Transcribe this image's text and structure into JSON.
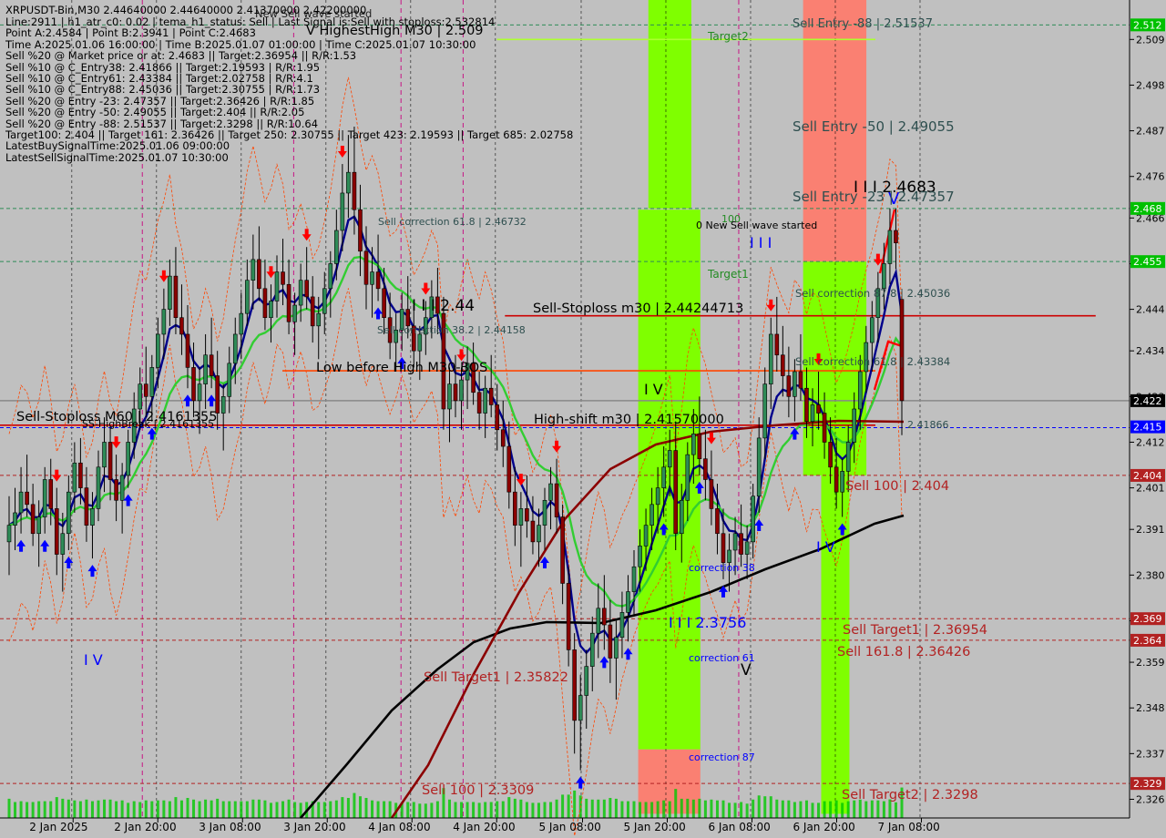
{
  "header": {
    "symbol": "XRPUSDT-Bin,M30",
    "ohlc": "2.44640000 2.44640000 2.41370000 2.42200000",
    "overlay_status": "New Sell wave started"
  },
  "info_lines": [
    "Line:2911 | h1_atr_c0: 0.02 | tema_h1_status: Sell | Last Signal is:Sell with stoploss:2.532814",
    "Point A:2.4584 | Point B:2.3941 | Point C:2.4683",
    "Time A:2025.01.06 16:00:00 | Time B:2025.01.07 01:00:00 | Time C:2025.01.07 10:30:00",
    "Sell %20 @ Market price or at: 2.4683 || Target:2.36954 || R/R:1.53",
    "Sell %10 @ C_Entry38: 2.41866 || Target:2.19593 | R/R:1.95",
    "Sell %10 @ C_Entry61: 2.43384 || Target:2.02758 | R/R:4.1",
    "Sell %10 @ C_Entry88: 2.45036 || Target:2.30755 | R/R:1.73",
    "Sell %20 @ Entry -23: 2.47357 || Target:2.36426 | R/R:1.85",
    "Sell %20 @ Entry -50: 2.49055 || Target:2.404 || R/R:2.05",
    "Sell %20 @ Entry -88: 2.51537 || Target:2.3298 || R/R:10.64",
    "Target100: 2.404 || Target 161: 2.36426 || Target 250: 2.30755 || Target 423: 2.19593 || Target 685: 2.02758",
    "LatestBuySignalTime:2025.01.06 09:00:00",
    "LatestSellSignalTime:2025.01.07 10:30:00"
  ],
  "chart_data": {
    "type": "candlestick",
    "symbol": "XRPUSDT-Bin",
    "timeframe": "M30",
    "ylim": [
      2.3215,
      2.5185
    ],
    "y_ticks": [
      "2.509",
      "2.498",
      "2.487",
      "2.476",
      "2.466",
      "2.455",
      "2.444",
      "2.434",
      "2.423",
      "2.412",
      "2.401",
      "2.391",
      "2.380",
      "2.369",
      "2.359",
      "2.348",
      "2.337",
      "2.326"
    ],
    "x_ticks": [
      "2 Jan 2025",
      "2 Jan 20:00",
      "3 Jan 08:00",
      "3 Jan 20:00",
      "4 Jan 08:00",
      "4 Jan 20:00",
      "5 Jan 08:00",
      "5 Jan 20:00",
      "6 Jan 08:00",
      "6 Jan 20:00",
      "7 Jan 08:00"
    ],
    "price_tags": [
      {
        "label": "2.512",
        "value": 2.5125,
        "color": "#00c000"
      },
      {
        "label": "2.468",
        "value": 2.4683,
        "color": "#00c000"
      },
      {
        "label": "2.455",
        "value": 2.4555,
        "color": "#00c000"
      },
      {
        "label": "2.422",
        "value": 2.422,
        "color": "#000000"
      },
      {
        "label": "2.415",
        "value": 2.4157,
        "color": "#0000ff"
      },
      {
        "label": "2.404",
        "value": 2.404,
        "color": "#b22222"
      },
      {
        "label": "2.369",
        "value": 2.3695,
        "color": "#b22222"
      },
      {
        "label": "2.364",
        "value": 2.3643,
        "color": "#b22222"
      },
      {
        "label": "2.329",
        "value": 2.3298,
        "color": "#b22222"
      }
    ],
    "horizontal_levels": [
      {
        "value": 2.509,
        "color": "#adff2f",
        "style": "solid"
      },
      {
        "value": 2.5125,
        "color": "#2e8b57",
        "style": "dash"
      },
      {
        "value": 2.4683,
        "color": "#2e8b57",
        "style": "dash"
      },
      {
        "value": 2.4555,
        "color": "#2e8b57",
        "style": "dash"
      },
      {
        "value": 2.44244713,
        "color": "#cc0000",
        "style": "solid"
      },
      {
        "value": 2.4292,
        "color": "#ff4500",
        "style": "solid"
      },
      {
        "value": 2.422,
        "color": "#888888",
        "style": "solid"
      },
      {
        "value": 2.4161,
        "color": "#cc0000",
        "style": "solid"
      },
      {
        "value": 2.4155,
        "color": "#0000ff",
        "style": "dash"
      },
      {
        "value": 2.404,
        "color": "#b22222",
        "style": "dash"
      },
      {
        "value": 2.3695,
        "color": "#b22222",
        "style": "dash"
      },
      {
        "value": 2.3643,
        "color": "#b22222",
        "style": "dash"
      },
      {
        "value": 2.3298,
        "color": "#b22222",
        "style": "dash"
      }
    ],
    "zones": [
      {
        "color": "#7fff00",
        "x0": 0.574,
        "x1": 0.612,
        "y_top": 2.5185,
        "y_bottom": 2.4683
      },
      {
        "color": "#7fff00",
        "x0": 0.565,
        "x1": 0.62,
        "y_top": 2.468,
        "y_bottom": 2.338
      },
      {
        "color": "#fa8072",
        "x0": 0.565,
        "x1": 0.62,
        "y_top": 2.338,
        "y_bottom": 2.3225
      },
      {
        "color": "#fa8072",
        "x0": 0.711,
        "x1": 0.767,
        "y_top": 2.5185,
        "y_bottom": 2.4555
      },
      {
        "color": "#7fff00",
        "x0": 0.711,
        "x1": 0.767,
        "y_top": 2.4555,
        "y_bottom": 2.404
      },
      {
        "color": "#7fff00",
        "x0": 0.727,
        "x1": 0.752,
        "y_top": 2.404,
        "y_bottom": 2.3225
      }
    ],
    "labels": [
      {
        "text": "Sell Entry -88 | 2.51537",
        "color": "#2f4f4f"
      },
      {
        "text": "Target2",
        "color": "#228b22"
      },
      {
        "text": "Sell Entry -50 | 2.49055",
        "color": "#2f4f4f"
      },
      {
        "text": "I I I 2.4683",
        "color": "#000000"
      },
      {
        "text": "V",
        "color": "#0000ff"
      },
      {
        "text": "Sell Entry -23 | 2.47357",
        "color": "#2f4f4f"
      },
      {
        "text": "Sell correction 61.8 | 2.46732",
        "color": "#2f4f4f"
      },
      {
        "text": "100",
        "color": "#228b22"
      },
      {
        "text": "0 New Sell wave started",
        "color": "#000000"
      },
      {
        "text": "I I I",
        "color": "#0000ff"
      },
      {
        "text": "Target1",
        "color": "#228b22"
      },
      {
        "text": "Sell correction 87.8 | 2.45036",
        "color": "#2f4f4f"
      },
      {
        "text": "I I I 2.44",
        "color": "#000000"
      },
      {
        "text": "Sell-Stoploss m30 | 2.44244713",
        "color": "#000000"
      },
      {
        "text": "Sell correction 38.2 | 2.44158",
        "color": "#2f4f4f"
      },
      {
        "text": "Sell correction 61.8 | 2.43384",
        "color": "#2f4f4f"
      },
      {
        "text": "Low before High   M30-BOS",
        "color": "#000000"
      },
      {
        "text": "I V",
        "color": "#000000"
      },
      {
        "text": "Sell-Stoploss M60 | 2.4161355",
        "color": "#000000"
      },
      {
        "text": "SS-HighBreak | 2.4161355",
        "color": "#000000"
      },
      {
        "text": "High-shift m30 | 2.41570000",
        "color": "#000000"
      },
      {
        "text": "2.41866",
        "color": "#2f4f4f"
      },
      {
        "text": "Sell 100 | 2.404",
        "color": "#b22222"
      },
      {
        "text": "I V",
        "color": "#0000ff"
      },
      {
        "text": "correction 38",
        "color": "#0000ff"
      },
      {
        "text": "I I I 2.3756",
        "color": "#0000ff"
      },
      {
        "text": "Sell Target1 | 2.36954",
        "color": "#b22222"
      },
      {
        "text": "Sell 161.8 | 2.36426",
        "color": "#b22222"
      },
      {
        "text": "I V",
        "color": "#0000ff"
      },
      {
        "text": "correction 61",
        "color": "#0000ff"
      },
      {
        "text": "V",
        "color": "#000000"
      },
      {
        "text": "Sell Target1 | 2.35822",
        "color": "#b22222"
      },
      {
        "text": "correction 87",
        "color": "#0000ff"
      },
      {
        "text": "Sell 100 | 2.3309",
        "color": "#b22222"
      },
      {
        "text": "Sell Target2 | 2.3298",
        "color": "#b22222"
      },
      {
        "text": "V   HighestHigh   M30 | 2.509",
        "color": "#000000"
      }
    ],
    "candles_ohlc": [
      [
        2.388,
        2.399,
        2.38,
        2.392
      ],
      [
        2.392,
        2.401,
        2.386,
        2.395
      ],
      [
        2.395,
        2.406,
        2.39,
        2.4
      ],
      [
        2.4,
        2.409,
        2.394,
        2.397
      ],
      [
        2.397,
        2.402,
        2.387,
        2.39
      ],
      [
        2.39,
        2.398,
        2.382,
        2.394
      ],
      [
        2.394,
        2.406,
        2.39,
        2.403
      ],
      [
        2.403,
        2.408,
        2.392,
        2.396
      ],
      [
        2.396,
        2.401,
        2.38,
        2.385
      ],
      [
        2.385,
        2.395,
        2.376,
        2.39
      ],
      [
        2.39,
        2.404,
        2.386,
        2.4
      ],
      [
        2.4,
        2.412,
        2.395,
        2.407
      ],
      [
        2.407,
        2.413,
        2.397,
        2.401
      ],
      [
        2.401,
        2.406,
        2.388,
        2.392
      ],
      [
        2.392,
        2.4,
        2.384,
        2.396
      ],
      [
        2.396,
        2.41,
        2.393,
        2.406
      ],
      [
        2.406,
        2.418,
        2.4,
        2.412
      ],
      [
        2.412,
        2.416,
        2.398,
        2.403
      ],
      [
        2.403,
        2.409,
        2.393,
        2.398
      ],
      [
        2.398,
        2.407,
        2.39,
        2.404
      ],
      [
        2.404,
        2.415,
        2.401,
        2.412
      ],
      [
        2.412,
        2.424,
        2.408,
        2.42
      ],
      [
        2.42,
        2.43,
        2.415,
        2.426
      ],
      [
        2.426,
        2.435,
        2.418,
        2.423
      ],
      [
        2.423,
        2.433,
        2.417,
        2.43
      ],
      [
        2.43,
        2.442,
        2.425,
        2.438
      ],
      [
        2.438,
        2.449,
        2.432,
        2.444
      ],
      [
        2.444,
        2.456,
        2.44,
        2.452
      ],
      [
        2.452,
        2.459,
        2.438,
        2.442
      ],
      [
        2.442,
        2.45,
        2.433,
        2.438
      ],
      [
        2.438,
        2.445,
        2.425,
        2.43
      ],
      [
        2.43,
        2.436,
        2.418,
        2.422
      ],
      [
        2.422,
        2.43,
        2.414,
        2.426
      ],
      [
        2.426,
        2.438,
        2.42,
        2.433
      ],
      [
        2.433,
        2.442,
        2.425,
        2.428
      ],
      [
        2.428,
        2.434,
        2.415,
        2.419
      ],
      [
        2.419,
        2.426,
        2.41,
        2.423
      ],
      [
        2.423,
        2.435,
        2.419,
        2.431
      ],
      [
        2.431,
        2.442,
        2.426,
        2.438
      ],
      [
        2.438,
        2.448,
        2.432,
        2.443
      ],
      [
        2.443,
        2.456,
        2.44,
        2.451
      ],
      [
        2.451,
        2.462,
        2.444,
        2.456
      ],
      [
        2.456,
        2.464,
        2.446,
        2.449
      ],
      [
        2.449,
        2.456,
        2.439,
        2.442
      ],
      [
        2.442,
        2.45,
        2.436,
        2.446
      ],
      [
        2.446,
        2.457,
        2.442,
        2.453
      ],
      [
        2.453,
        2.461,
        2.445,
        2.45
      ],
      [
        2.45,
        2.456,
        2.438,
        2.441
      ],
      [
        2.441,
        2.448,
        2.433,
        2.445
      ],
      [
        2.445,
        2.455,
        2.441,
        2.451
      ],
      [
        2.451,
        2.459,
        2.444,
        2.447
      ],
      [
        2.447,
        2.452,
        2.436,
        2.44
      ],
      [
        2.44,
        2.447,
        2.432,
        2.443
      ],
      [
        2.443,
        2.453,
        2.438,
        2.449
      ],
      [
        2.449,
        2.458,
        2.442,
        2.455
      ],
      [
        2.455,
        2.468,
        2.451,
        2.463
      ],
      [
        2.463,
        2.479,
        2.458,
        2.472
      ],
      [
        2.472,
        2.486,
        2.466,
        2.477
      ],
      [
        2.477,
        2.488,
        2.462,
        2.468
      ],
      [
        2.468,
        2.474,
        2.452,
        2.458
      ],
      [
        2.458,
        2.464,
        2.444,
        2.45
      ],
      [
        2.45,
        2.459,
        2.442,
        2.453
      ],
      [
        2.453,
        2.462,
        2.446,
        2.449
      ],
      [
        2.449,
        2.454,
        2.438,
        2.442
      ],
      [
        2.442,
        2.448,
        2.432,
        2.436
      ],
      [
        2.436,
        2.443,
        2.429,
        2.439
      ],
      [
        2.439,
        2.448,
        2.434,
        2.444
      ],
      [
        2.444,
        2.452,
        2.437,
        2.44
      ],
      [
        2.44,
        2.445,
        2.43,
        2.434
      ],
      [
        2.434,
        2.44,
        2.427,
        2.438
      ],
      [
        2.438,
        2.446,
        2.433,
        2.442
      ],
      [
        2.442,
        2.451,
        2.437,
        2.447
      ],
      [
        2.447,
        2.454,
        2.438,
        2.443
      ],
      [
        2.443,
        2.447,
        2.415,
        2.42
      ],
      [
        2.42,
        2.43,
        2.412,
        2.426
      ],
      [
        2.426,
        2.433,
        2.418,
        2.422
      ],
      [
        2.422,
        2.43,
        2.415,
        2.427
      ],
      [
        2.427,
        2.435,
        2.42,
        2.431
      ],
      [
        2.431,
        2.436,
        2.421,
        2.424
      ],
      [
        2.424,
        2.429,
        2.415,
        2.419
      ],
      [
        2.419,
        2.428,
        2.413,
        2.425
      ],
      [
        2.425,
        2.433,
        2.418,
        2.421
      ],
      [
        2.421,
        2.426,
        2.41,
        2.415
      ],
      [
        2.415,
        2.422,
        2.406,
        2.411
      ],
      [
        2.411,
        2.417,
        2.396,
        2.4
      ],
      [
        2.4,
        2.406,
        2.387,
        2.392
      ],
      [
        2.392,
        2.4,
        2.382,
        2.396
      ],
      [
        2.396,
        2.404,
        2.389,
        2.393
      ],
      [
        2.393,
        2.399,
        2.385,
        2.388
      ],
      [
        2.388,
        2.396,
        2.382,
        2.392
      ],
      [
        2.392,
        2.401,
        2.386,
        2.398
      ],
      [
        2.398,
        2.406,
        2.391,
        2.402
      ],
      [
        2.402,
        2.408,
        2.39,
        2.394
      ],
      [
        2.394,
        2.397,
        2.373,
        2.378
      ],
      [
        2.378,
        2.382,
        2.358,
        2.362
      ],
      [
        2.362,
        2.366,
        2.337,
        2.345
      ],
      [
        2.345,
        2.356,
        2.333,
        2.351
      ],
      [
        2.351,
        2.362,
        2.343,
        2.358
      ],
      [
        2.358,
        2.37,
        2.352,
        2.366
      ],
      [
        2.366,
        2.378,
        2.36,
        2.372
      ],
      [
        2.372,
        2.38,
        2.362,
        2.368
      ],
      [
        2.368,
        2.374,
        2.354,
        2.36
      ],
      [
        2.36,
        2.369,
        2.35,
        2.365
      ],
      [
        2.365,
        2.376,
        2.36,
        2.371
      ],
      [
        2.371,
        2.38,
        2.364,
        2.376
      ],
      [
        2.376,
        2.386,
        2.37,
        2.382
      ],
      [
        2.382,
        2.391,
        2.376,
        2.387
      ],
      [
        2.387,
        2.396,
        2.381,
        2.392
      ],
      [
        2.392,
        2.401,
        2.386,
        2.397
      ],
      [
        2.397,
        2.406,
        2.39,
        2.401
      ],
      [
        2.401,
        2.411,
        2.394,
        2.406
      ],
      [
        2.406,
        2.415,
        2.399,
        2.41
      ],
      [
        2.41,
        2.417,
        2.386,
        2.39
      ],
      [
        2.39,
        2.402,
        2.383,
        2.398
      ],
      [
        2.398,
        2.412,
        2.393,
        2.409
      ],
      [
        2.409,
        2.42,
        2.402,
        2.414
      ],
      [
        2.414,
        2.423,
        2.404,
        2.408
      ],
      [
        2.408,
        2.415,
        2.398,
        2.403
      ],
      [
        2.403,
        2.41,
        2.392,
        2.396
      ],
      [
        2.396,
        2.402,
        2.385,
        2.39
      ],
      [
        2.39,
        2.396,
        2.379,
        2.383
      ],
      [
        2.383,
        2.39,
        2.376,
        2.386
      ],
      [
        2.386,
        2.394,
        2.38,
        2.39
      ],
      [
        2.39,
        2.397,
        2.382,
        2.385
      ],
      [
        2.385,
        2.392,
        2.379,
        2.388
      ],
      [
        2.388,
        2.402,
        2.384,
        2.399
      ],
      [
        2.399,
        2.418,
        2.395,
        2.413
      ],
      [
        2.413,
        2.43,
        2.408,
        2.426
      ],
      [
        2.426,
        2.442,
        2.42,
        2.438
      ],
      [
        2.438,
        2.447,
        2.429,
        2.433
      ],
      [
        2.433,
        2.44,
        2.423,
        2.428
      ],
      [
        2.428,
        2.435,
        2.418,
        2.423
      ],
      [
        2.423,
        2.432,
        2.417,
        2.429
      ],
      [
        2.429,
        2.438,
        2.422,
        2.425
      ],
      [
        2.425,
        2.43,
        2.413,
        2.417
      ],
      [
        2.417,
        2.425,
        2.411,
        2.421
      ],
      [
        2.421,
        2.429,
        2.415,
        2.419
      ],
      [
        2.419,
        2.424,
        2.408,
        2.412
      ],
      [
        2.412,
        2.418,
        2.402,
        2.406
      ],
      [
        2.406,
        2.413,
        2.396,
        2.4
      ],
      [
        2.4,
        2.408,
        2.394,
        2.405
      ],
      [
        2.405,
        2.416,
        2.4,
        2.412
      ],
      [
        2.412,
        2.424,
        2.407,
        2.42
      ],
      [
        2.42,
        2.433,
        2.415,
        2.429
      ],
      [
        2.429,
        2.44,
        2.424,
        2.436
      ],
      [
        2.436,
        2.446,
        2.429,
        2.442
      ],
      [
        2.442,
        2.453,
        2.436,
        2.449
      ],
      [
        2.449,
        2.46,
        2.444,
        2.455
      ],
      [
        2.455,
        2.4683,
        2.45,
        2.463
      ],
      [
        2.463,
        2.4683,
        2.4537,
        2.46
      ],
      [
        2.4464,
        2.4464,
        2.4137,
        2.422
      ]
    ]
  }
}
